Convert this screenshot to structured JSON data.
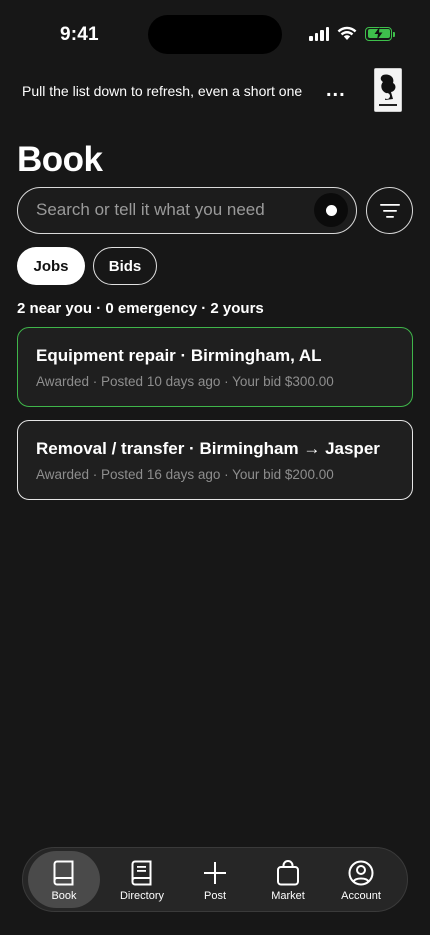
{
  "status_bar": {
    "time": "9:41",
    "icons": [
      "signal-icon",
      "wifi-icon",
      "battery-charging-icon"
    ],
    "battery_color": "#3ec04c"
  },
  "banner": {
    "text": "Pull the list down to refresh, even a short one",
    "more_label": "...",
    "thumbnail_icon": "book-cover-icon"
  },
  "page": {
    "title": "Book"
  },
  "search": {
    "placeholder": "Search or tell it what you need",
    "value": "",
    "voice_icon": "record-icon",
    "filter_icon": "filter-icon"
  },
  "segments": {
    "items": [
      {
        "label": "Jobs",
        "selected": true
      },
      {
        "label": "Bids",
        "selected": false
      }
    ]
  },
  "summary": {
    "text": "2 near you · 0 emergency · 2 yours"
  },
  "jobs": [
    {
      "title": "Equipment repair · Birmingham, AL",
      "meta": "Awarded · Posted 10 days ago · Your bid $300.00",
      "highlighted": true
    },
    {
      "title": "Removal / transfer · Birmingham → Jasper",
      "meta": "Awarded · Posted 16 days ago · Your bid $200.00",
      "highlighted": false
    }
  ],
  "tab_bar": {
    "items": [
      {
        "label": "Book",
        "icon": "book-icon",
        "active": true
      },
      {
        "label": "Directory",
        "icon": "directory-icon",
        "active": false
      },
      {
        "label": "Post",
        "icon": "plus-icon",
        "active": false
      },
      {
        "label": "Market",
        "icon": "bag-icon",
        "active": false
      },
      {
        "label": "Account",
        "icon": "account-icon",
        "active": false
      }
    ]
  },
  "colors": {
    "background": "#171717",
    "highlight_border": "#3fb54a",
    "muted_text": "#8e8e8e"
  }
}
